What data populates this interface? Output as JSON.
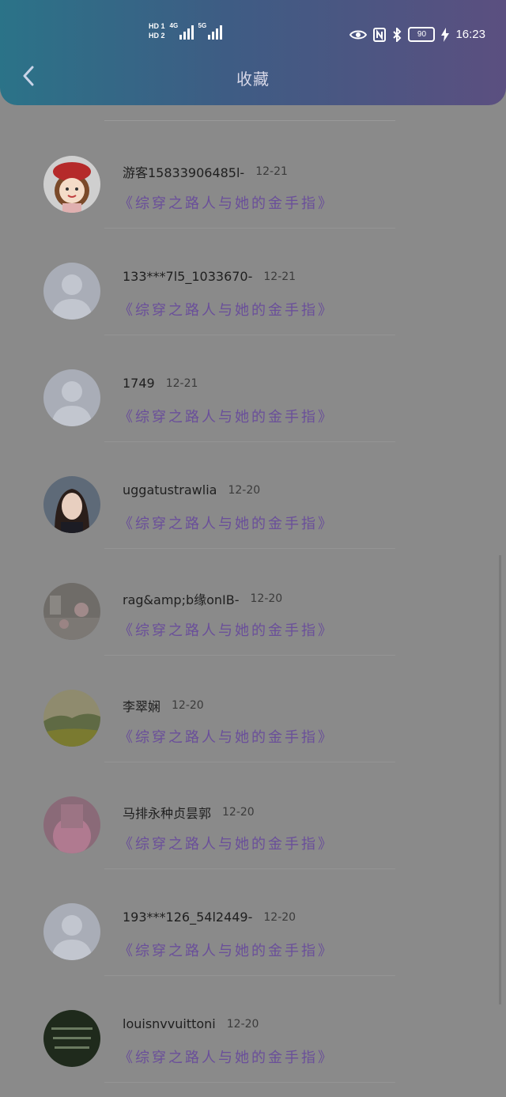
{
  "status_bar": {
    "hd1": "HD 1",
    "hd2": "HD 2",
    "net1": "4G",
    "net2": "5G",
    "battery": "90",
    "time": "16:23"
  },
  "header": {
    "title": "收藏"
  },
  "items": [
    {
      "name": "游客15833906485l-",
      "date": "12-21",
      "book": "《综穿之路人与她的金手指》",
      "avatar": "cartoon-girl"
    },
    {
      "name": "133***7l5_1033670-",
      "date": "12-21",
      "book": "《综穿之路人与她的金手指》",
      "avatar": "default"
    },
    {
      "name": "1749",
      "date": "12-21",
      "book": "《综穿之路人与她的金手指》",
      "avatar": "default"
    },
    {
      "name": "uggatustrawlia",
      "date": "12-20",
      "book": "《综穿之路人与她的金手指》",
      "avatar": "portrait"
    },
    {
      "name": "rag&amp;b缘onIB-",
      "date": "12-20",
      "book": "《综穿之路人与她的金手指》",
      "avatar": "room"
    },
    {
      "name": "李翠娴",
      "date": "12-20",
      "book": "《综穿之路人与她的金手指》",
      "avatar": "landscape"
    },
    {
      "name": "马排永种贞昙郭",
      "date": "12-20",
      "book": "《综穿之路人与她的金手指》",
      "avatar": "pink"
    },
    {
      "name": "193***126_54l2449-",
      "date": "12-20",
      "book": "《综穿之路人与她的金手指》",
      "avatar": "default"
    },
    {
      "name": "louisnvvuittoni",
      "date": "12-20",
      "book": "《综穿之路人与她的金手指》",
      "avatar": "dark-text"
    }
  ],
  "colors": {
    "header_start": "#2b7388",
    "header_end": "#5b4f80",
    "overlay_bg": "#8a8a8a",
    "book_title": "#6a4f9a"
  }
}
